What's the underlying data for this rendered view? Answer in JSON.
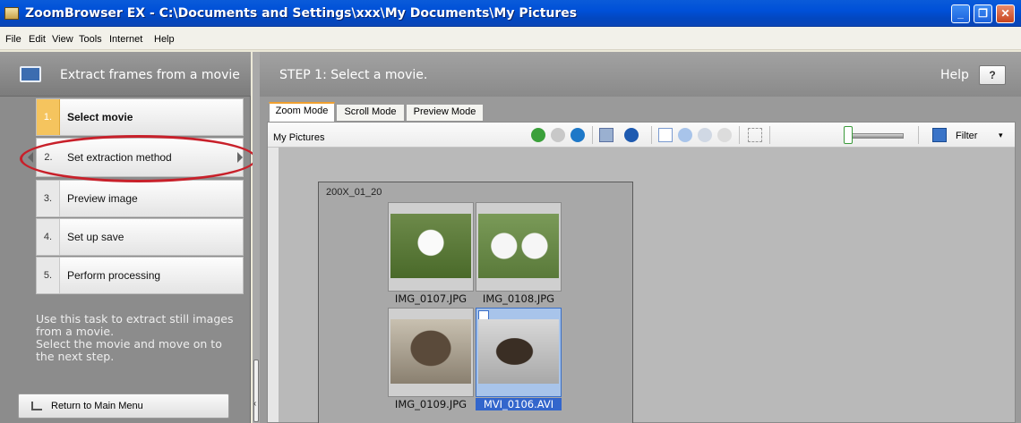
{
  "window": {
    "title": "ZoomBrowser EX  -  C:\\Documents and Settings\\xxx\\My Documents\\My Pictures",
    "controls": {
      "minimize": "_",
      "restore": "❐",
      "close": "✕"
    }
  },
  "menu": [
    "File",
    "Edit",
    "View",
    "Tools",
    "Internet",
    "Help"
  ],
  "left_panel": {
    "title": "Extract frames from a movie",
    "steps": [
      {
        "num": "1.",
        "label": "Select movie"
      },
      {
        "num": "2.",
        "label": "Set extraction method"
      },
      {
        "num": "3.",
        "label": "Preview image"
      },
      {
        "num": "4.",
        "label": "Set up save"
      },
      {
        "num": "5.",
        "label": "Perform processing"
      }
    ],
    "description": "Use this task to extract still images from a movie.\nSelect the movie and move on to the next step.",
    "return_button": "Return to Main Menu"
  },
  "right_panel": {
    "step_title": "STEP 1: Select a movie.",
    "help_label": "Help",
    "help_button": "?",
    "tabs": [
      "Zoom Mode",
      "Scroll Mode",
      "Preview Mode"
    ],
    "folder": "My Pictures",
    "filter_label": "Filter",
    "filter_caret": "▾",
    "group_label": "200X_01_20",
    "thumbnails": [
      {
        "name": "IMG_0107.JPG",
        "selected": false
      },
      {
        "name": "IMG_0108.JPG",
        "selected": false
      },
      {
        "name": "IMG_0109.JPG",
        "selected": false
      },
      {
        "name": "MVI_0106.AVI",
        "selected": true
      }
    ]
  },
  "colors": {
    "accent": "#f5c45e",
    "highlight_ellipse": "#c8202a",
    "selection": "#3366cc"
  },
  "icons": [
    "back-icon",
    "forward-icon",
    "up-icon",
    "view-icon",
    "info-icon",
    "pointer-icon",
    "zoom-in-icon",
    "zoom-out-icon",
    "hand-icon",
    "fit-icon",
    "filter-icon"
  ]
}
